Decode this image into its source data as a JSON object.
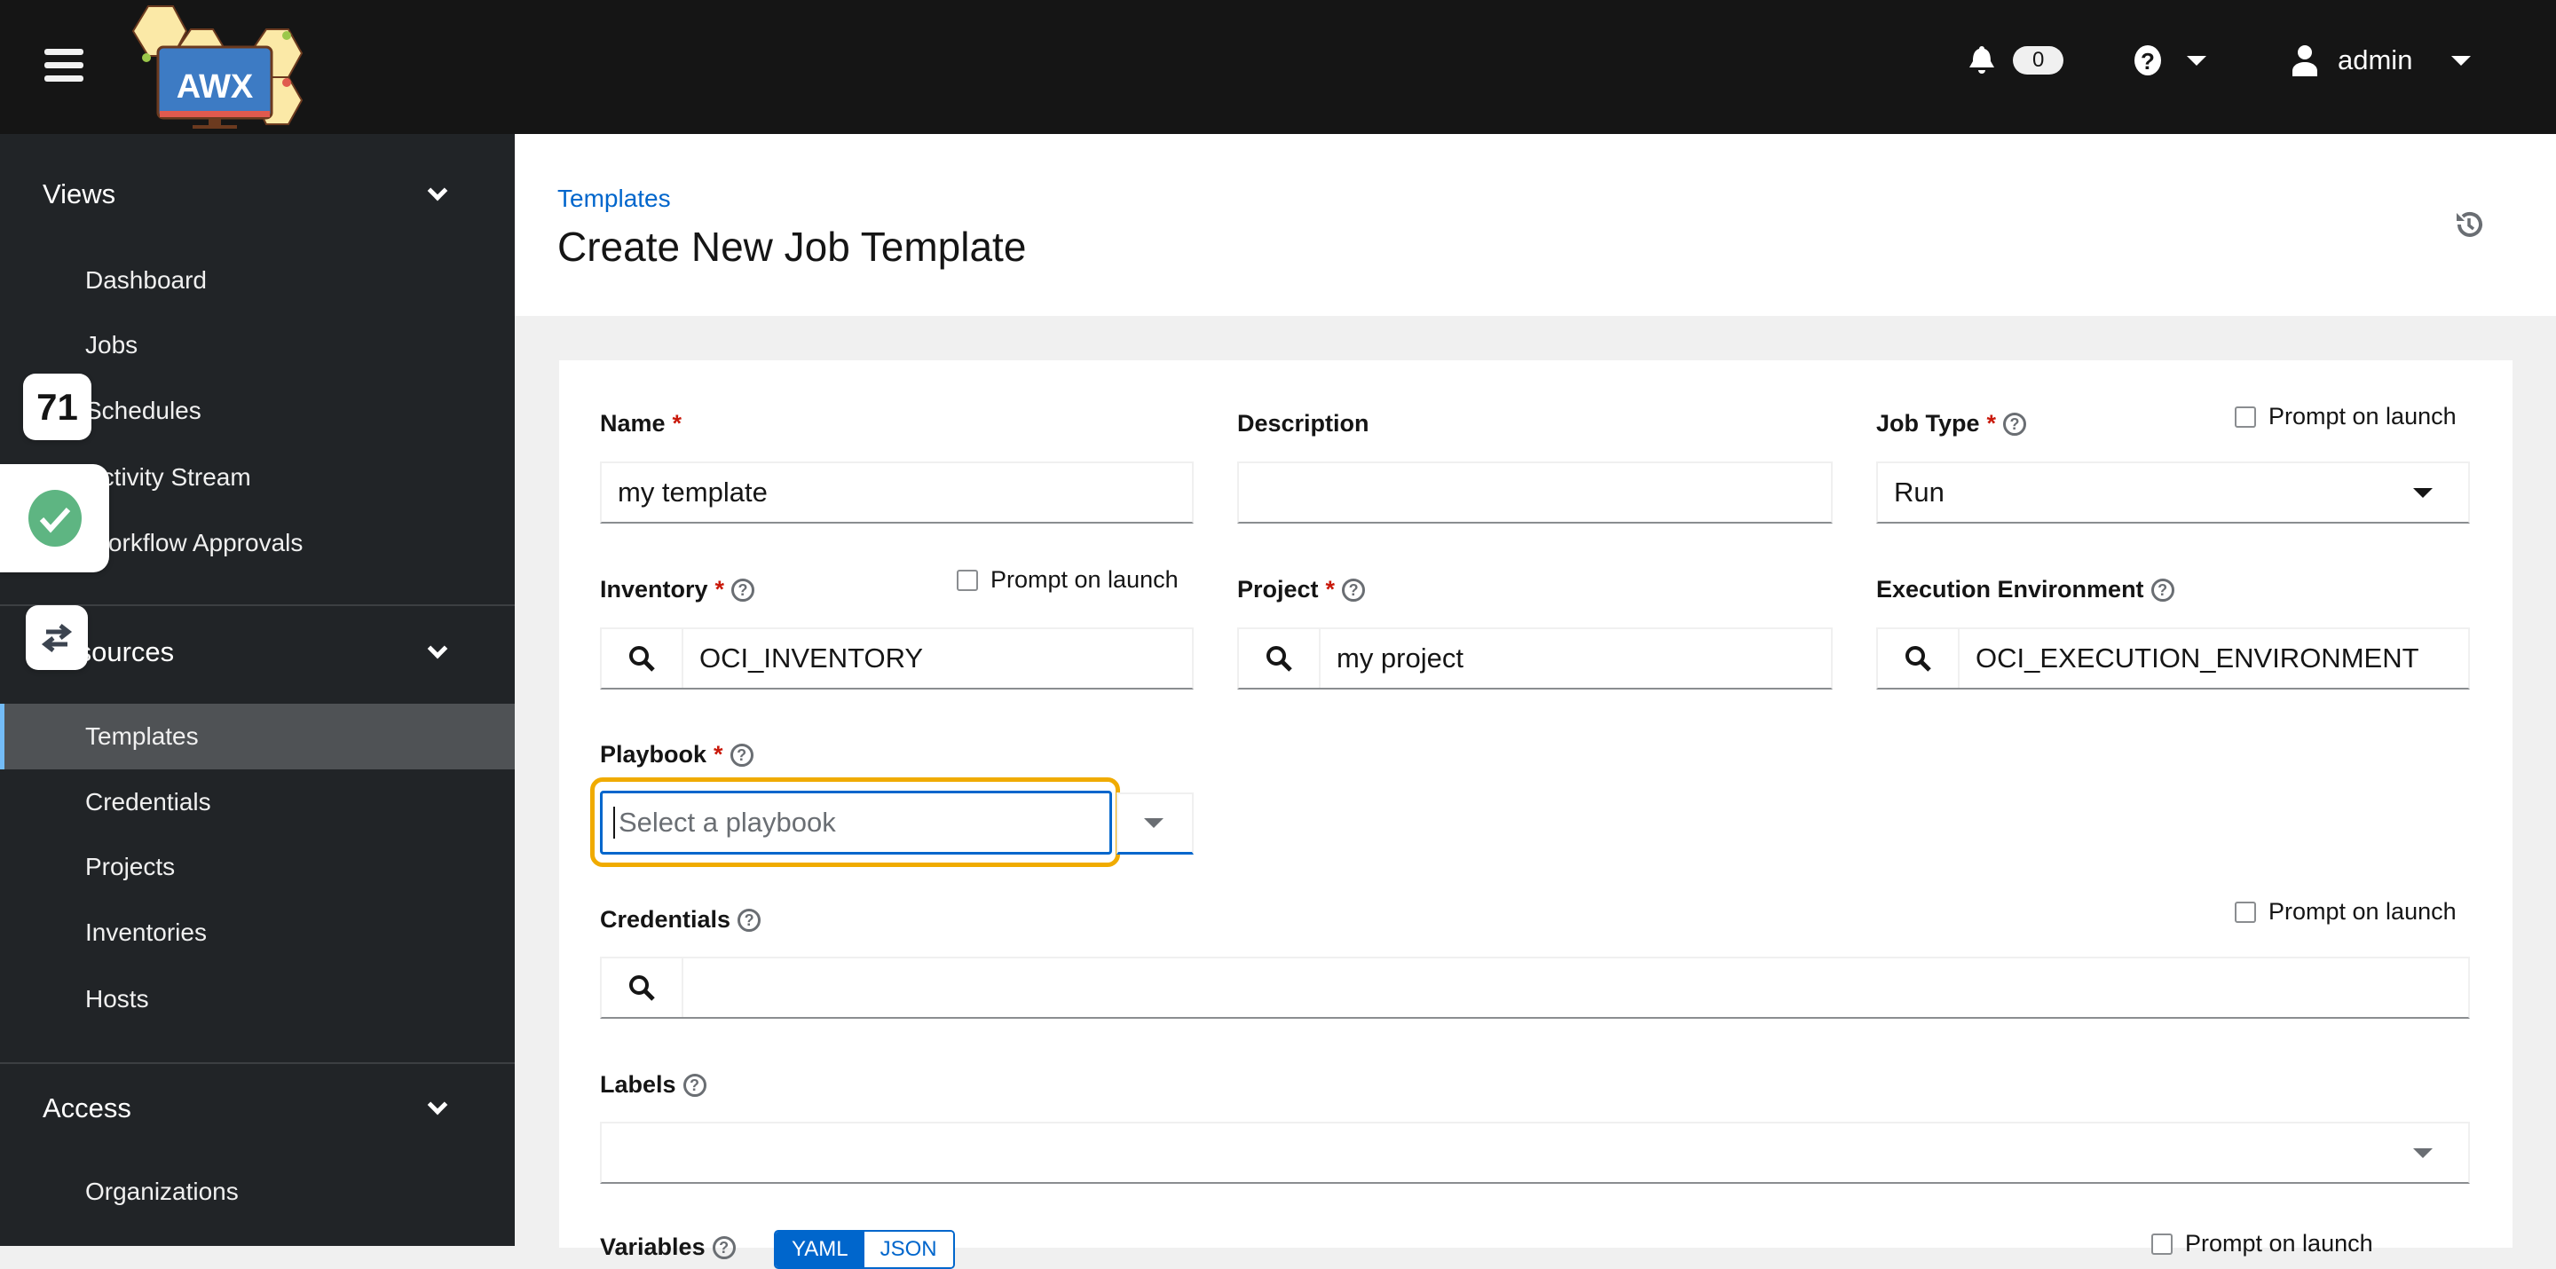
{
  "header": {
    "logo_text": "AWX",
    "notification_count": "0",
    "user": "admin",
    "icons": [
      "hamburger-icon",
      "bell-icon",
      "question-circle-icon",
      "user-icon"
    ]
  },
  "sidebar": {
    "groups": [
      {
        "label": "Views",
        "items": [
          "Dashboard",
          "Jobs",
          "Schedules",
          "Activity Stream",
          "Workflow Approvals"
        ]
      },
      {
        "label": "Resources",
        "items": [
          "Templates",
          "Credentials",
          "Projects",
          "Inventories",
          "Hosts"
        ]
      },
      {
        "label": "Access",
        "items": [
          "Organizations"
        ]
      }
    ],
    "active": "Templates"
  },
  "overlays": {
    "counter": "71",
    "status_icon": "check-circle-icon",
    "swap_icon": "arrows-swap-icon"
  },
  "page": {
    "breadcrumb": "Templates",
    "title": "Create New Job Template"
  },
  "form": {
    "name": {
      "label": "Name",
      "value": "my template"
    },
    "description": {
      "label": "Description",
      "value": ""
    },
    "job_type": {
      "label": "Job Type",
      "value": "Run"
    },
    "inventory": {
      "label": "Inventory",
      "value": "OCI_INVENTORY"
    },
    "project": {
      "label": "Project",
      "value": "my project"
    },
    "execution_environment": {
      "label": "Execution Environment",
      "value": "OCI_EXECUTION_ENVIRONMENT"
    },
    "playbook": {
      "label": "Playbook",
      "placeholder": "Select a playbook"
    },
    "credentials": {
      "label": "Credentials",
      "value": ""
    },
    "labels": {
      "label": "Labels",
      "value": ""
    },
    "variables": {
      "label": "Variables",
      "toggle": [
        "YAML",
        "JSON"
      ],
      "selected": "YAML"
    },
    "prompt_on_launch": "Prompt on launch",
    "required_mark": "*"
  },
  "colors": {
    "accent": "#0066cc",
    "focus_ring": "#f0ab00",
    "header_bg": "#151515",
    "sidebar_bg": "#212427"
  }
}
